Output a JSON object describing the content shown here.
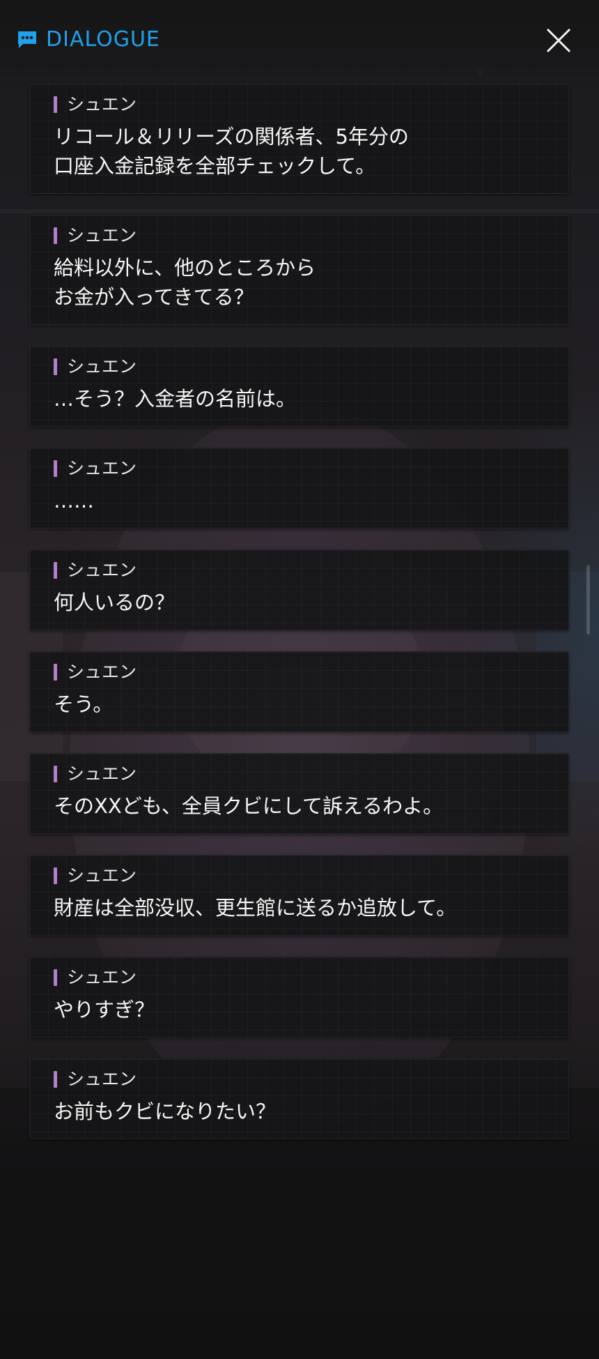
{
  "header": {
    "title": "DIALOGUE",
    "title_icon": "chat-bubble-icon",
    "close_icon": "close-icon",
    "accent_color": "#1fa2ea"
  },
  "speaker_accent_color": "#b27fc9",
  "dialogue": [
    {
      "speaker": "シュエン",
      "text": "リコール＆リリーズの関係者、5年分の\n口座入金記録を全部チェックして。"
    },
    {
      "speaker": "シュエン",
      "text": "給料以外に、他のところから\nお金が入ってきてる？"
    },
    {
      "speaker": "シュエン",
      "text": "…そう？入金者の名前は。"
    },
    {
      "speaker": "シュエン",
      "text": "……"
    },
    {
      "speaker": "シュエン",
      "text": "何人いるの？"
    },
    {
      "speaker": "シュエン",
      "text": "そう。"
    },
    {
      "speaker": "シュエン",
      "text": "そのXXども、全員クビにして訴えるわよ。"
    },
    {
      "speaker": "シュエン",
      "text": "財産は全部没収、更生館に送るか追放して。"
    },
    {
      "speaker": "シュエン",
      "text": "やりすぎ？"
    },
    {
      "speaker": "シュエン",
      "text": "お前もクビになりたい？"
    }
  ]
}
